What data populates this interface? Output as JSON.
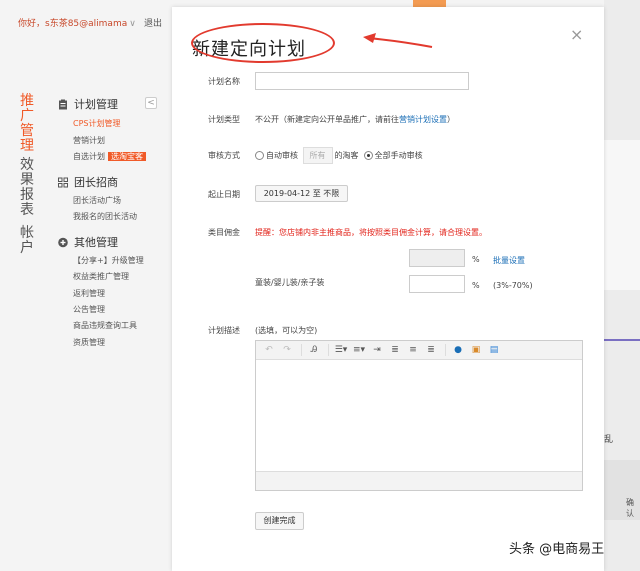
{
  "header": {
    "greeting": "你好，s东茶85@alimama",
    "greeting_chevron": "∨",
    "logout": "退出"
  },
  "side_tabs": {
    "promote": [
      "推",
      "广",
      "管",
      "理"
    ],
    "reports": [
      "效",
      "果",
      "报",
      "表"
    ],
    "account": [
      "帐",
      "户"
    ]
  },
  "collapse_icon": "<",
  "menu": {
    "plan_head": "计划管理",
    "plan_items": [
      "CPS计划管理",
      "营销计划",
      "自选计划"
    ],
    "select_badge": "选淘宝客",
    "group_head": "团长招商",
    "group_items": [
      "团长活动广场",
      "我报名的团长活动"
    ],
    "other_head": "其他管理",
    "other_items": [
      "【分享+】升级管理",
      "权益类推广管理",
      "返利管理",
      "公告管理",
      "商品违规查询工具",
      "资质管理"
    ]
  },
  "modal": {
    "title": "新建定向计划",
    "close": "×",
    "fields": {
      "name_label": "计划名称",
      "type_label": "计划类型",
      "type_text_pre": "不公开（新建定向公开单品推广，请前往",
      "type_link": "营销计划设置",
      "type_text_post": "）",
      "review_label": "审核方式",
      "review_auto": "自动审核",
      "review_auto_pill": "所有",
      "review_auto_post": "的淘客",
      "review_manual": "全部手动审核",
      "date_label": "起止日期",
      "date_value": "2019-04-12 至 不限",
      "commission_label": "类目佣金",
      "commission_warning": "提醒：您店铺内非主推商品，将按照类目佣金计算，请合理设置。",
      "percent": "%",
      "batch_link": "批量设置",
      "category_name": "童装/婴儿装/亲子装",
      "range": "(3%-70%)",
      "desc_label": "计划描述",
      "desc_hint": "(选填，可以为空)",
      "submit": "创建完成"
    }
  },
  "editor_tools": [
    "undo-icon",
    "redo-icon",
    "format-icon",
    "bullet-list-icon",
    "numbered-list-icon",
    "indent-icon",
    "align-left-icon",
    "align-center-icon",
    "align-right-icon",
    "link-icon",
    "image-icon",
    "table-icon"
  ],
  "bg_right": {
    "dot": "乱",
    "confirm": "确认"
  },
  "watermark": "头条 @电商易王",
  "colors": {
    "accent": "#f05a28",
    "link": "#1a6eb6",
    "warning": "#e2231a",
    "annotation": "#e23a2e"
  }
}
